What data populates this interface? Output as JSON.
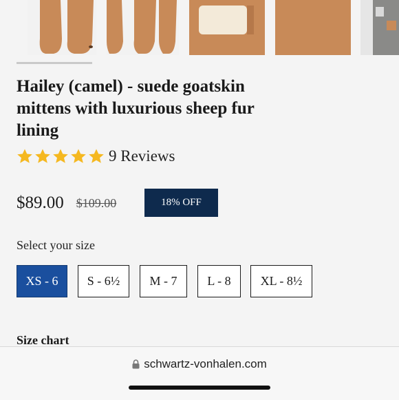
{
  "product": {
    "title": "Hailey (camel) - suede goatskin mittens with luxurious sheep fur lining",
    "rating_stars": 5,
    "reviews_text": "9 Reviews",
    "price": "$89.00",
    "original_price": "$109.00",
    "discount_badge": "18% OFF"
  },
  "size": {
    "label": "Select your size",
    "options": [
      "XS - 6",
      "S - 6½",
      "M - 7",
      "L - 8",
      "XL - 8½"
    ],
    "selected": "XS - 6"
  },
  "size_chart_label": "Size chart",
  "browser": {
    "url": "schwartz-vonhalen.com"
  },
  "colors": {
    "accent": "#1a4f9e",
    "badge": "#0e2a4d",
    "star": "#f5b820",
    "camel": "#c88a58"
  },
  "icons": {
    "star": "star-icon",
    "lock": "lock-icon"
  }
}
